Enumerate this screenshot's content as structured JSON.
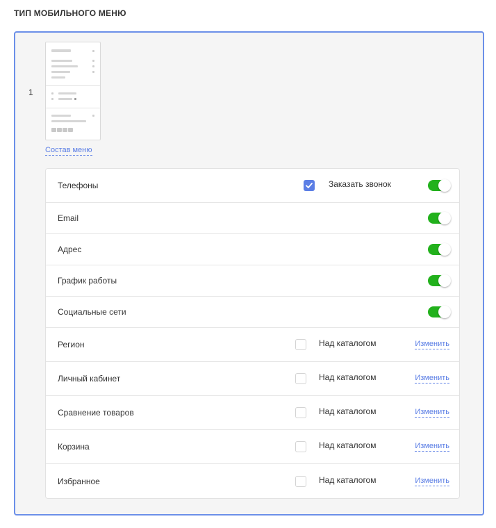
{
  "section": {
    "title": "ТИП МОБИЛЬНОГО МЕНЮ"
  },
  "option": {
    "number": "1",
    "compose_link": "Состав меню"
  },
  "rows": [
    {
      "label": "Телефоны",
      "checkbox_label": "Заказать звонок",
      "checkbox_checked": true,
      "toggle_on": true
    },
    {
      "label": "Email",
      "toggle_on": true
    },
    {
      "label": "Адрес",
      "toggle_on": true
    },
    {
      "label": "График работы",
      "toggle_on": true
    },
    {
      "label": "Социальные сети",
      "toggle_on": true
    },
    {
      "label": "Регион",
      "checkbox_label": "Над каталогом",
      "checkbox_checked": false,
      "action": "Изменить"
    },
    {
      "label": "Личный кабинет",
      "checkbox_label": "Над каталогом",
      "checkbox_checked": false,
      "action": "Изменить"
    },
    {
      "label": "Сравнение товаров",
      "checkbox_label": "Над каталогом",
      "checkbox_checked": false,
      "action": "Изменить"
    },
    {
      "label": "Корзина",
      "checkbox_label": "Над каталогом",
      "checkbox_checked": false,
      "action": "Изменить"
    },
    {
      "label": "Избранное",
      "checkbox_label": "Над каталогом",
      "checkbox_checked": false,
      "action": "Изменить"
    }
  ],
  "colors": {
    "accent": "#5b7ee5",
    "panel_border": "#6b8fe8",
    "toggle_on": "#22b11c"
  }
}
